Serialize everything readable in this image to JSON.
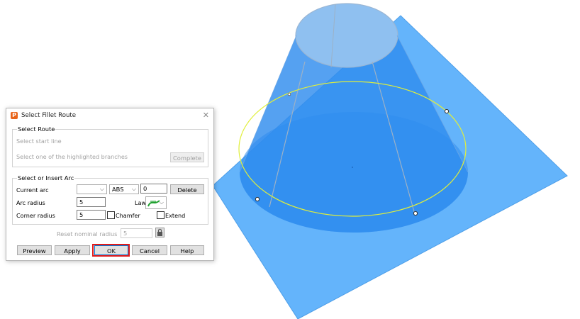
{
  "colors": {
    "sheet": "#64b4fb",
    "cone_body": "#2f8cee",
    "cone_top": "#8fc0f0",
    "highlight_curve": "#e0ef3a",
    "ok_highlight": "#e01a1a",
    "app_icon": "#e8641b"
  },
  "dialog": {
    "title": "Select Fillet Route",
    "app_icon_letter": "P",
    "close_icon": "close-icon",
    "route": {
      "group_label": "Select Route",
      "start_line_prompt": "Select start line",
      "branches_prompt": "Select one of the highlighted branches",
      "complete_label": "Complete"
    },
    "arc": {
      "group_label": "Select or Insert Arc",
      "current_arc_label": "Current arc",
      "current_arc_value": "",
      "mode_value": "ABS",
      "offset_value": "0",
      "delete_label": "Delete",
      "arc_radius_label": "Arc radius",
      "arc_radius_value": "5",
      "law_label": "Law",
      "law_icon": "law-curve-icon",
      "corner_radius_label": "Corner radius",
      "corner_radius_value": "5",
      "chamfer_label": "Chamfer",
      "chamfer_checked": false,
      "extend_label": "Extend",
      "extend_checked": false
    },
    "reset": {
      "label": "Reset nominal radius",
      "value": "5",
      "lock_icon": "lock-icon"
    },
    "buttons": {
      "preview": "Preview",
      "apply": "Apply",
      "ok": "OK",
      "cancel": "Cancel",
      "help": "Help"
    }
  }
}
